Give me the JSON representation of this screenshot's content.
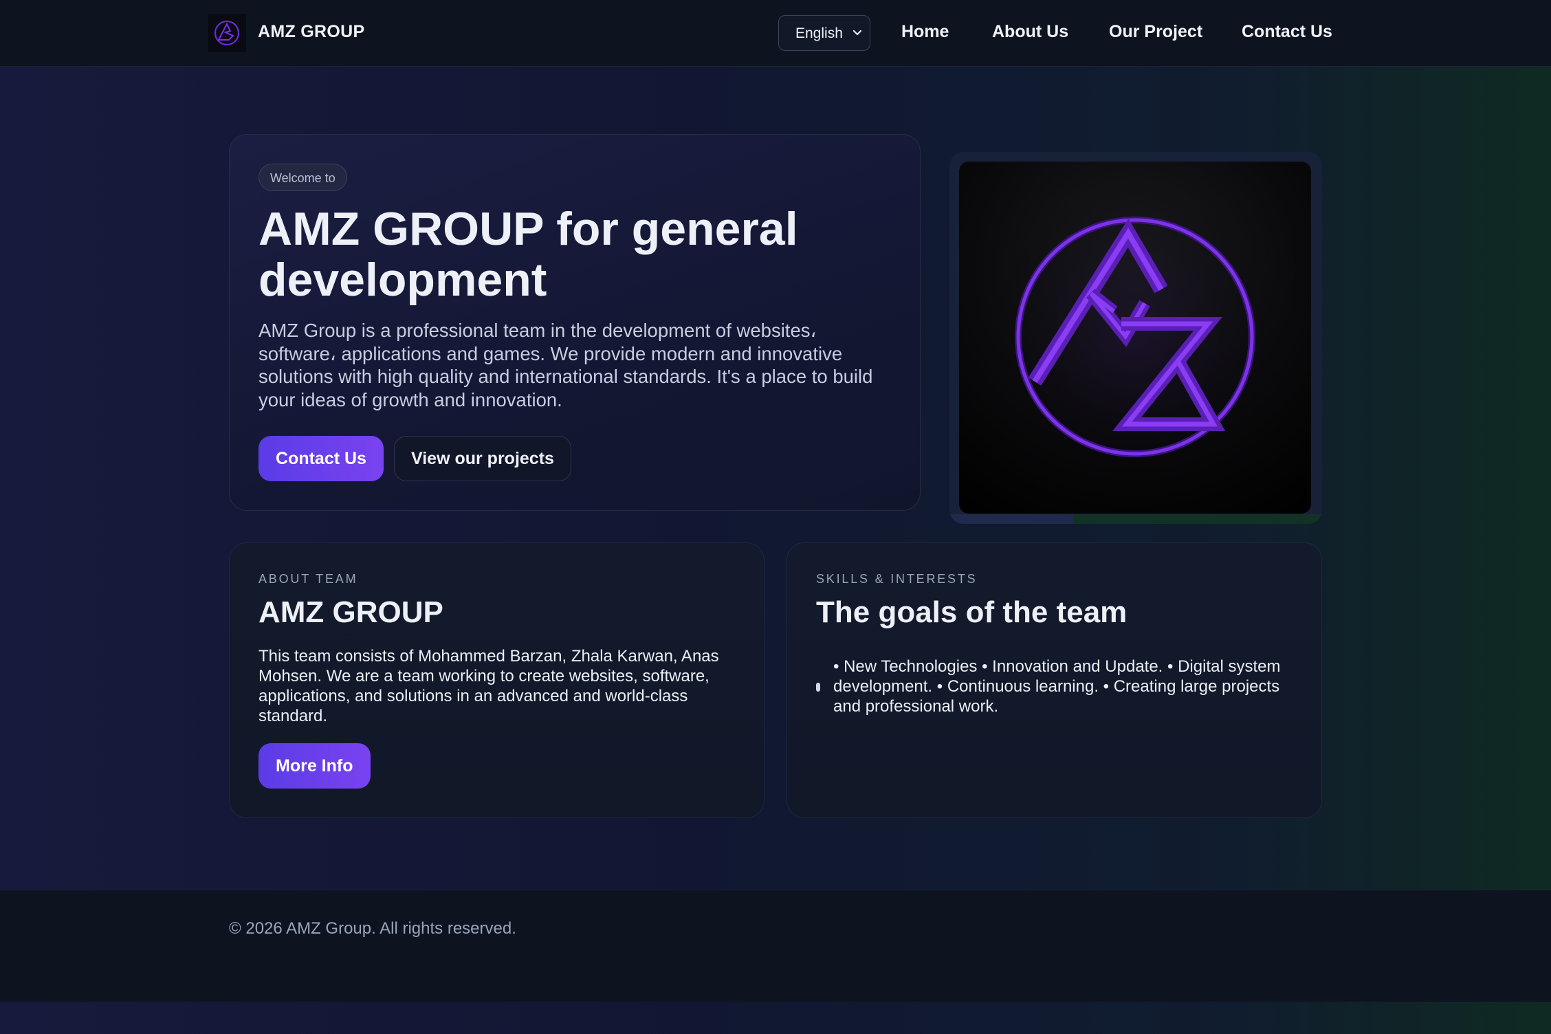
{
  "header": {
    "brand_name": "AMZ GROUP",
    "language": "English",
    "nav": [
      {
        "label": "Home"
      },
      {
        "label": "About Us"
      },
      {
        "label": "Our Project"
      },
      {
        "label": "Contact Us"
      }
    ]
  },
  "hero": {
    "pill": "Welcome to",
    "title": "AMZ GROUP for general development",
    "description": "AMZ Group is a professional team in the development of websites، software، applications and games. We provide modern and innovative solutions with high quality and international standards. It's a place to build your ideas of growth and innovation.",
    "primary_button": "Contact Us",
    "secondary_button": "View our projects"
  },
  "about": {
    "eyebrow": "ABOUT TEAM",
    "title": "AMZ GROUP",
    "text": "This team consists of Mohammed Barzan, Zhala Karwan, Anas Mohsen. We are a team working to create websites, software, applications, and solutions in an advanced and world-class standard.",
    "button": "More Info"
  },
  "goals": {
    "eyebrow": "SKILLS & INTERESTS",
    "title": "The goals of the team",
    "text": "• New Technologies • Innovation and Update. • Digital system development. • Continuous learning. • Creating large projects and professional work."
  },
  "footer": {
    "text": "© 2026 AMZ Group. All rights reserved."
  },
  "colors": {
    "accent_start": "#5a3ce6",
    "accent_end": "#7a42f0",
    "logo_purple": "#7b2ff0",
    "header_bg": "#0d1420"
  },
  "icons": {
    "brand": "amz-logo-icon",
    "dropdown": "chevron-down-icon"
  }
}
